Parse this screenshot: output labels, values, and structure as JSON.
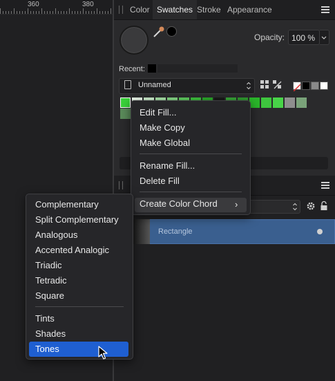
{
  "ruler": {
    "labels": [
      "360",
      "380"
    ]
  },
  "panel": {
    "tabs": [
      {
        "label": "Color"
      },
      {
        "label": "Swatches"
      },
      {
        "label": "Stroke"
      },
      {
        "label": "Appearance"
      }
    ],
    "active_tab": "Swatches",
    "opacity_label": "Opacity:",
    "opacity_value": "100 %",
    "recent_label": "Recent:",
    "palette_name": "Unnamed",
    "swatch_colors_row1": [
      "#3ad13a",
      "#e8f5e8",
      "#cdeecd",
      "#a8e3a8",
      "#86d886",
      "#5fcc5f",
      "#3ec13e",
      "#2aa82a",
      "#1a1a1a",
      "#37a437",
      "#2f9a2f",
      "#2ab52a",
      "#3ec63e",
      "#48d448",
      "#8e8e8e",
      "#7aa37a"
    ],
    "swatch_colors_row2": [
      "#5a8a5a"
    ],
    "chip_colors": [
      "#ffffff",
      "#000000",
      "#8a8a8a",
      "#ffffff"
    ]
  },
  "layers": {
    "row_label": "Rectangle"
  },
  "context_menu": {
    "items": [
      "Edit Fill...",
      "Make Copy",
      "Make Global",
      "Rename Fill...",
      "Delete Fill",
      "Create Color Chord"
    ]
  },
  "submenu": {
    "items": [
      "Complementary",
      "Split Complementary",
      "Analogous",
      "Accented Analogic",
      "Triadic",
      "Tetradic",
      "Square",
      "Tints",
      "Shades",
      "Tones"
    ],
    "highlight": "#1f5fd1"
  }
}
